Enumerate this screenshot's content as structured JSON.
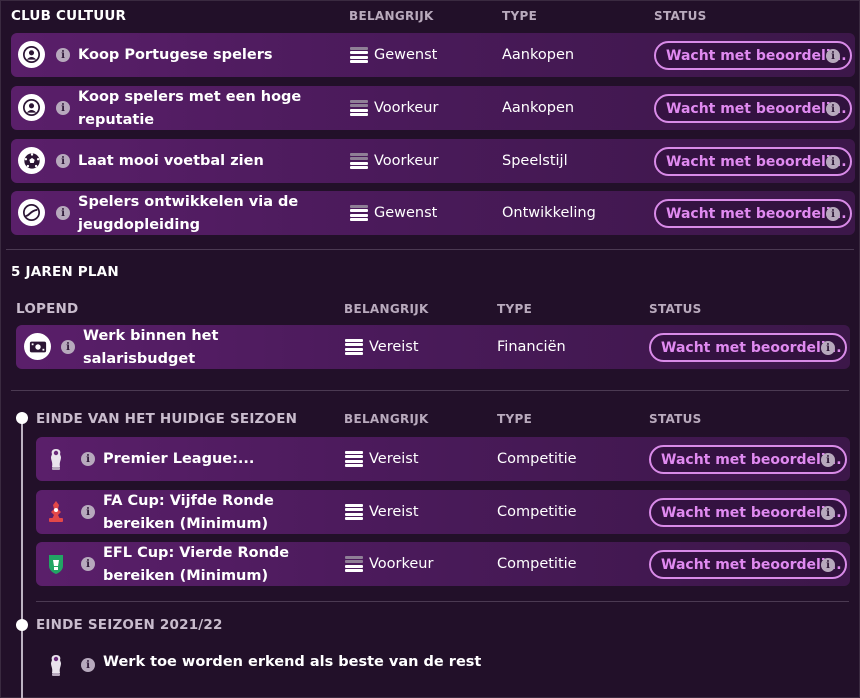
{
  "club_culture": {
    "title": "CLUB CULTUUR",
    "headers": {
      "importance": "BELANGRIJK",
      "type": "TYPE",
      "status": "STATUS"
    },
    "rows": [
      {
        "title": "Koop Portugese spelers",
        "importance": "Gewenst",
        "type": "Aankopen",
        "status": "Wacht met beoordeli...",
        "icon": "person-icon"
      },
      {
        "title": "Koop spelers met een hoge reputatie",
        "importance": "Voorkeur",
        "type": "Aankopen",
        "status": "Wacht met beoordeli...",
        "icon": "person-icon"
      },
      {
        "title": "Laat mooi voetbal zien",
        "importance": "Voorkeur",
        "type": "Speelstijl",
        "status": "Wacht met beoordeli...",
        "icon": "football-icon"
      },
      {
        "title": "Spelers ontwikkelen via de jeugdopleiding",
        "importance": "Gewenst",
        "type": "Ontwikkeling",
        "status": "Wacht met beoordeli...",
        "icon": "growth-icon"
      }
    ]
  },
  "five_year_plan": {
    "title": "5 JAREN PLAN",
    "ongoing": {
      "title": "LOPEND",
      "headers": {
        "importance": "BELANGRIJK",
        "type": "TYPE",
        "status": "STATUS"
      },
      "rows": [
        {
          "title": "Werk binnen het salarisbudget",
          "importance": "Vereist",
          "type": "Financiën",
          "status": "Wacht met beoordeli...",
          "icon": "money-icon"
        }
      ]
    },
    "season_end": {
      "title": "EINDE VAN HET HUIDIGE SEIZOEN",
      "headers": {
        "importance": "BELANGRIJK",
        "type": "TYPE",
        "status": "STATUS"
      },
      "rows": [
        {
          "title": "Premier League:...",
          "importance": "Vereist",
          "type": "Competitie",
          "status": "Wacht met beoordeli...",
          "icon": "premier-league-crest-icon"
        },
        {
          "title": "FA Cup: Vijfde Ronde bereiken (Minimum)",
          "importance": "Vereist",
          "type": "Competitie",
          "status": "Wacht met beoordeli...",
          "icon": "fa-cup-crest-icon"
        },
        {
          "title": "EFL Cup: Vierde Ronde bereiken (Minimum)",
          "importance": "Voorkeur",
          "type": "Competitie",
          "status": "Wacht met beoordeli...",
          "icon": "efl-cup-crest-icon"
        }
      ]
    },
    "season_2021": {
      "title": "EINDE SEIZOEN 2021/22",
      "rows": [
        {
          "title": "Werk toe worden erkend als beste van de rest",
          "icon": "premier-league-crest-icon"
        }
      ]
    }
  },
  "info_glyph": "i"
}
